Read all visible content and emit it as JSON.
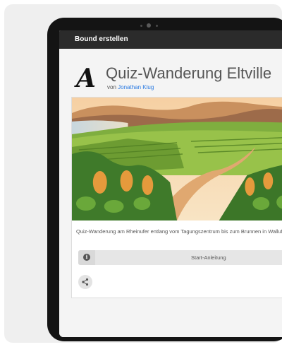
{
  "app": {
    "bar_title": "Bound erstellen"
  },
  "tour": {
    "logo_letter": "A",
    "title": "Quiz-Wanderung Eltville",
    "by_prefix": "von",
    "author": "Jonathan Klug",
    "description": "Quiz-Wanderung am Rheinufer entlang vom Tagungszentrum bis zum Brunnen in Walluf",
    "start_label": "Start-Anleitung"
  },
  "icons": {
    "logo": "stylized-a-logo",
    "info": "info-icon",
    "share": "share-icon"
  },
  "colors": {
    "appbar": "#2b2b2b",
    "link": "#2a7ae2",
    "background": "#efefef"
  }
}
